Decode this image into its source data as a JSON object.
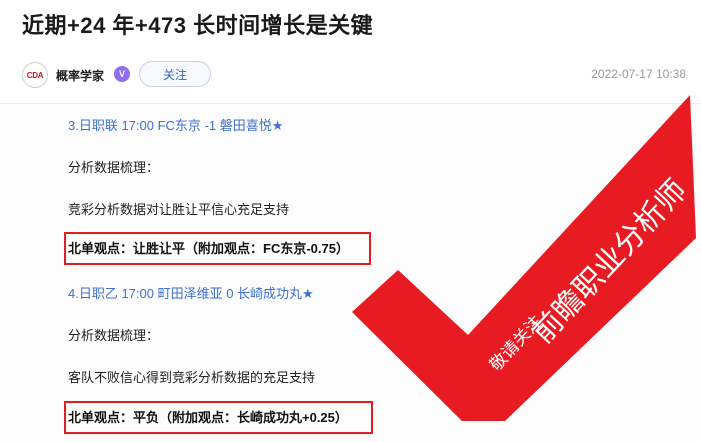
{
  "article": {
    "title": "近期+24 年+473 长时间增长是关键",
    "author": {
      "name": "概率学家",
      "avatar_text": "CDA",
      "verified_icon": "vip-badge-icon",
      "follow_label": "关注"
    },
    "timestamp": "2022-07-17 10:38"
  },
  "content": {
    "match1": {
      "title": "3.日职联 17:00 FC东京 -1 磐田喜悦★",
      "analysis_heading": "分析数据梳理：",
      "analysis_text": "竞彩分析数据对让胜让平信心充足支持",
      "pick": "北单观点：让胜让平（附加观点：FC东京-0.75）"
    },
    "match2": {
      "title": "4.日职乙 17:00 町田泽维亚 0 长崎成功丸★",
      "analysis_heading": "分析数据梳理：",
      "analysis_text": "客队不败信心得到竞彩分析数据的充足支持",
      "pick": "北单观点：平负（附加观点：长崎成功丸+0.25）"
    }
  },
  "watermark": {
    "line1": "前瞻职业分析师",
    "line2": "敬请关注",
    "color": "#e8141b"
  },
  "colors": {
    "accent_blue": "#3d6fcc",
    "highlight_red": "#e02020"
  }
}
